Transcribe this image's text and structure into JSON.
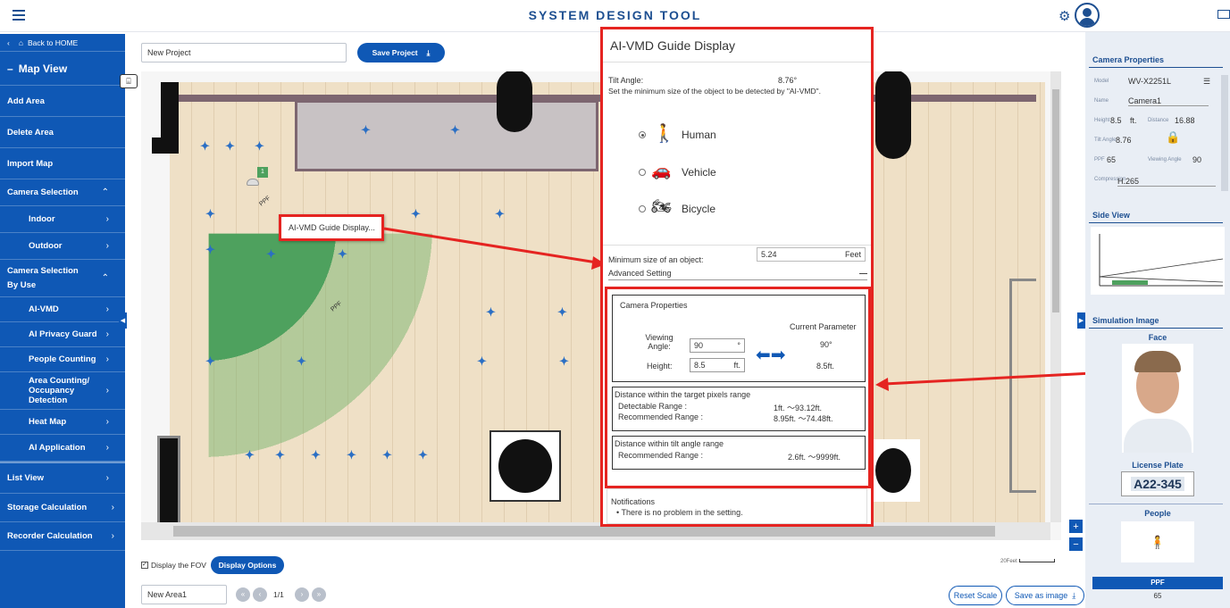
{
  "app": {
    "title": "SYSTEM DESIGN TOOL"
  },
  "sidebar": {
    "back": "Back to HOME",
    "map_view": "Map View",
    "items": [
      {
        "label": "Add Area"
      },
      {
        "label": "Delete Area"
      },
      {
        "label": "Import Map"
      },
      {
        "label": "Camera Selection"
      },
      {
        "label": "Indoor"
      },
      {
        "label": "Outdoor"
      },
      {
        "label": "Camera Selection By Use"
      },
      {
        "label": "AI-VMD"
      },
      {
        "label": "AI Privacy Guard"
      },
      {
        "label": "People Counting"
      },
      {
        "label": "Area Counting/ Occupancy Detection"
      },
      {
        "label": "Heat Map"
      },
      {
        "label": "AI Application"
      },
      {
        "label": "List View"
      },
      {
        "label": "Storage Calculation"
      },
      {
        "label": "Recorder Calculation"
      }
    ]
  },
  "project": {
    "name": "New Project",
    "save_label": "Save Project"
  },
  "map": {
    "context_menu": "AI-VMD Guide Display...",
    "fov_label_a": "PPF",
    "fov_label_b": "PPF",
    "camera_number": "1"
  },
  "bottom": {
    "display_fov": "Display the FOV",
    "display_options": "Display Options",
    "area_name": "New Area1",
    "page": "1/1",
    "scale_label": "20Feet",
    "reset_scale": "Reset Scale",
    "save_image": "Save as image"
  },
  "guide": {
    "title": "AI-VMD Guide Display",
    "tilt_label": "Tilt Angle:",
    "tilt_value": "8.76°",
    "instruction": "Set the minimum size of the object to be detected by \"AI-VMD\".",
    "options": [
      {
        "label": "Human",
        "icon": "person-walking-icon",
        "selected": true
      },
      {
        "label": "Vehicle",
        "icon": "car-icon",
        "selected": false
      },
      {
        "label": "Bicycle",
        "icon": "motorcycle-icon",
        "selected": false
      }
    ],
    "min_size_label": "Minimum size of an object:",
    "min_size_value": "5.24",
    "min_size_unit": "Feet",
    "advanced": "Advanced Setting",
    "cam_props_title": "Camera Properties",
    "current_param": "Current Parameter",
    "viewing_angle_label": "Viewing Angle:",
    "viewing_angle_value": "90",
    "viewing_angle_unit": "°",
    "viewing_angle_current": "90°",
    "height_label": "Height:",
    "height_value": "8.5",
    "height_unit": "ft.",
    "height_current": "8.5ft.",
    "pixels_title": "Distance within the target pixels range",
    "detectable_label": "Detectable Range :",
    "detectable_value": "1ft. ～93.12ft.",
    "recommended_label": "Recommended Range :",
    "recommended_value": "8.95ft. ～74.48ft.",
    "tilt_title": "Distance within tilt angle range",
    "tilt_rec_label": "Recommended Range :",
    "tilt_rec_value": "2.6ft. ～9999ft.",
    "notifications_title": "Notifications",
    "notification": "There is no problem in the setting."
  },
  "right": {
    "cam_props": "Camera Properties",
    "model_label": "Model",
    "model_value": "WV-X2251L",
    "name_label": "Name",
    "name_value": "Camera1",
    "height_label": "Height",
    "height_value": "8.5",
    "height_unit": "ft.",
    "distance_label": "Distance",
    "distance_value": "16.88",
    "tilt_label": "Tilt Angle",
    "tilt_value": "8.76",
    "ppf_label": "PPF",
    "ppf_value": "65",
    "viewing_label": "Viewing Angle",
    "viewing_value": "90",
    "compression_label": "Compression",
    "compression_value": "H.265",
    "side_view": "Side View",
    "simulation": "Simulation Image",
    "face": "Face",
    "license_plate": "License Plate",
    "plate_text": "A22-345",
    "people": "People",
    "ppf_footer": "PPF",
    "ppf_footer_value": "65"
  }
}
